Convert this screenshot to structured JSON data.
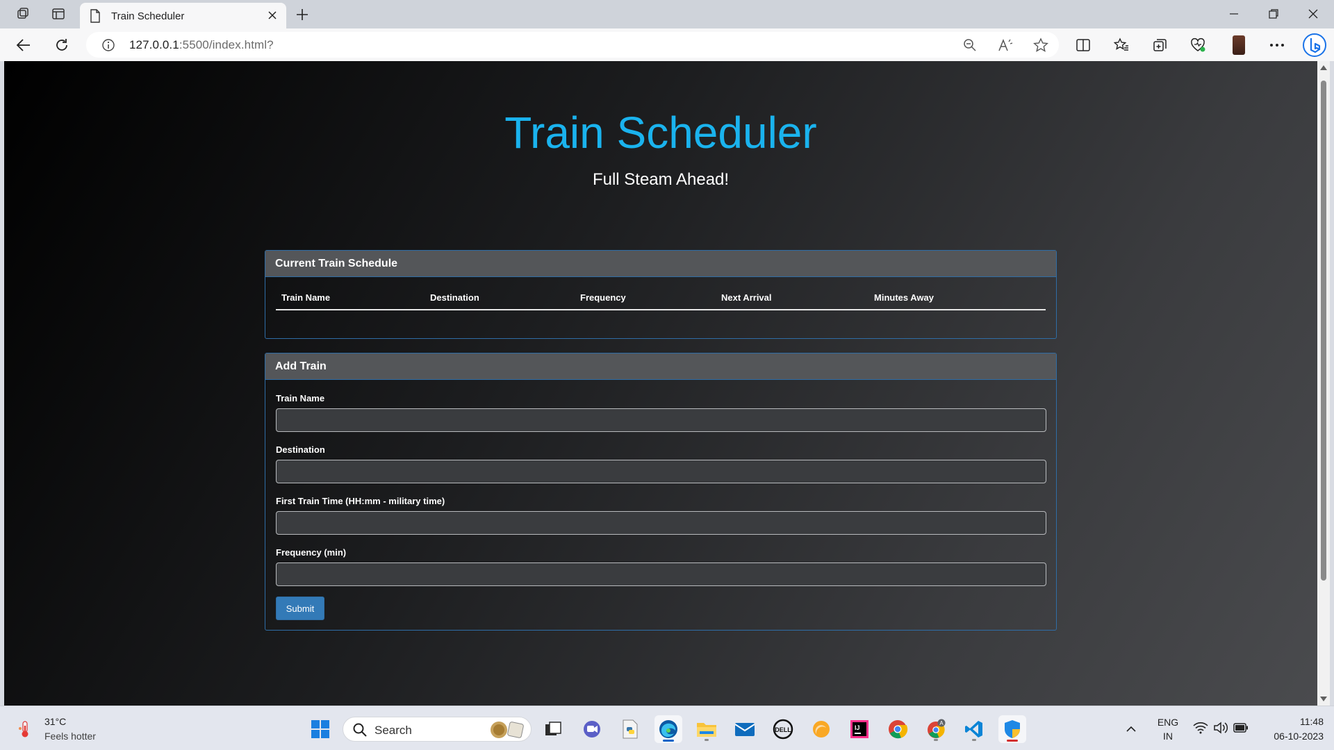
{
  "browser": {
    "tab_title": "Train Scheduler",
    "url_host": "127.0.0.1",
    "url_rest": ":5500/index.html?"
  },
  "page": {
    "title": "Train Scheduler",
    "subtitle": "Full Steam Ahead!",
    "title_color": "#1ab3ee"
  },
  "schedule": {
    "heading": "Current Train Schedule",
    "columns": [
      "Train Name",
      "Destination",
      "Frequency",
      "Next Arrival",
      "Minutes Away"
    ],
    "rows": []
  },
  "add_train": {
    "heading": "Add Train",
    "fields": [
      {
        "label": "Train Name",
        "value": ""
      },
      {
        "label": "Destination",
        "value": ""
      },
      {
        "label": "First Train Time (HH:mm - military time)",
        "value": ""
      },
      {
        "label": "Frequency (min)",
        "value": ""
      }
    ],
    "submit_label": "Submit",
    "submit_color": "#337ab7"
  },
  "taskbar": {
    "weather_temp": "31°C",
    "weather_desc": "Feels hotter",
    "search_label": "Search",
    "lang_top": "ENG",
    "lang_bottom": "IN",
    "time": "11:48",
    "date": "06-10-2023"
  }
}
